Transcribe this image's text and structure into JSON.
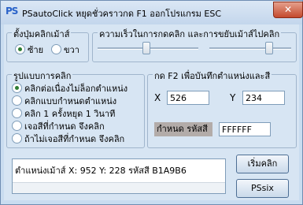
{
  "titlebar": {
    "icon_text": "PS",
    "title": "PSautoClick หยุดชั่วคราวกด F1 ออกโปรแกรม ESC",
    "close_label": "✕"
  },
  "side": {
    "legend": "ตั้งปุ่มคลิกเม้าส์",
    "options": [
      "ซ้าย",
      "ขวา"
    ],
    "selected": 0
  },
  "speed": {
    "legend": "ความเร็วในการกดคลิก และการขยับเม้าส์ไปคลิก",
    "slider1_value": 0.48,
    "slider2_value": 0.75
  },
  "mode": {
    "legend": "รูปแบบการคลิก",
    "options": [
      "คลิกต่อเนื่องไม่ล็อกตำแหน่ง",
      "คลิกแบบกำหนดตำแหน่ง",
      "คลิก 1 ครั้งหยุด 1 วินาที",
      "เจอสีที่กำหนด จึงคลิก",
      "ถ้าไม่เจอสีที่กำหนด จึงคลิก"
    ],
    "selected": 0
  },
  "position": {
    "legend": "กด F2 เพื่อบันทึกตำแหน่งและสี",
    "x_label": "X",
    "x_value": "526",
    "y_label": "Y",
    "y_value": "234",
    "color_label": "กำหนด รหัสสี",
    "color_value": "FFFFFF"
  },
  "status": {
    "text": "ตำแหน่งเม้าส์  X: 952  Y: 228    รหัสสี B1A9B6"
  },
  "buttons": {
    "start": "เริ่มคลิก",
    "pssix": "PSsix"
  },
  "colors": {
    "window_bg": "#d7e5f3",
    "close": "#c44a2e",
    "color_swatch": "#b3aca9"
  }
}
